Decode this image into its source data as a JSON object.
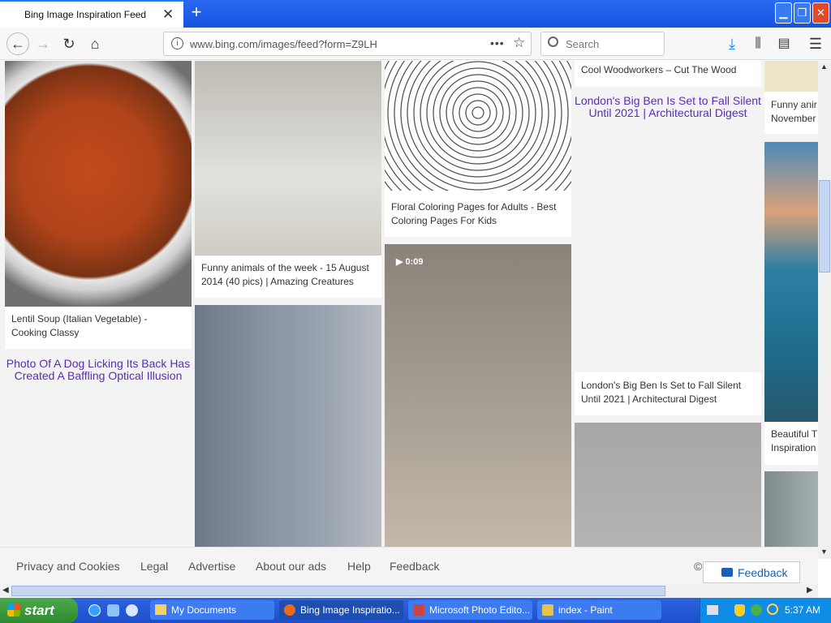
{
  "browser": {
    "tab_title": "Bing Image Inspiration Feed",
    "url": "www.bing.com/images/feed?form=Z9LH",
    "search_placeholder": "Search",
    "new_tab": "+",
    "close_tab": "✕"
  },
  "feed": {
    "col1": {
      "card1_caption": "Lentil Soup (Italian Vegetable) - Cooking Classy",
      "link": "Photo Of A Dog Licking Its Back Has Created A Baffling Optical Illusion"
    },
    "col2": {
      "card1_caption": "Funny animals of the week - 15 August 2014 (40 pics) | Amazing Creatures"
    },
    "col3": {
      "card1_caption": "Floral Coloring Pages for Adults - Best Coloring Pages For Kids",
      "video_duration": "▶ 0:09"
    },
    "col4": {
      "top_caption": "Cool Woodworkers – Cut The Wood",
      "link": "London's Big Ben Is Set to Fall Silent Until 2021 | Architectural Digest",
      "card_caption": "London's Big Ben Is Set to Fall Silent Until 2021 | Architectural Digest"
    },
    "col5": {
      "caption1": "Funny anir November",
      "caption2": "Beautiful T Inspiration"
    }
  },
  "footer": {
    "links": [
      "Privacy and Cookies",
      "Legal",
      "Advertise",
      "About our ads",
      "Help",
      "Feedback"
    ],
    "copyright": "©",
    "feedback_button": "Feedback"
  },
  "taskbar": {
    "start": "start",
    "items": [
      "My Documents",
      "Bing Image Inspiratio...",
      "Microsoft Photo Edito...",
      "index - Paint"
    ],
    "clock": "5:37 AM"
  },
  "colors": {
    "link": "#5a2db5",
    "taskbar": "#2d63e0",
    "start": "#3f9b3f"
  }
}
